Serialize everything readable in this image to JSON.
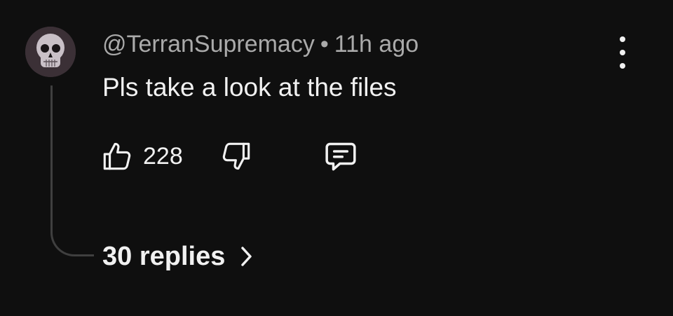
{
  "comment": {
    "author": "@TerranSupremacy",
    "separator": "•",
    "time": "11h ago",
    "text": "Pls take a look at the files",
    "likes": "228",
    "replies_label": "30 replies",
    "avatar_icon": "skull-avatar",
    "icons": [
      "thumbs-up-icon",
      "thumbs-down-icon",
      "reply-icon",
      "more-vert-icon",
      "chevron-right-icon"
    ]
  },
  "colors": {
    "background": "#0f0f0f",
    "primary_text": "#f1f1f1",
    "secondary_text": "#aaaaaa",
    "thread_line": "#3f3f3f"
  }
}
